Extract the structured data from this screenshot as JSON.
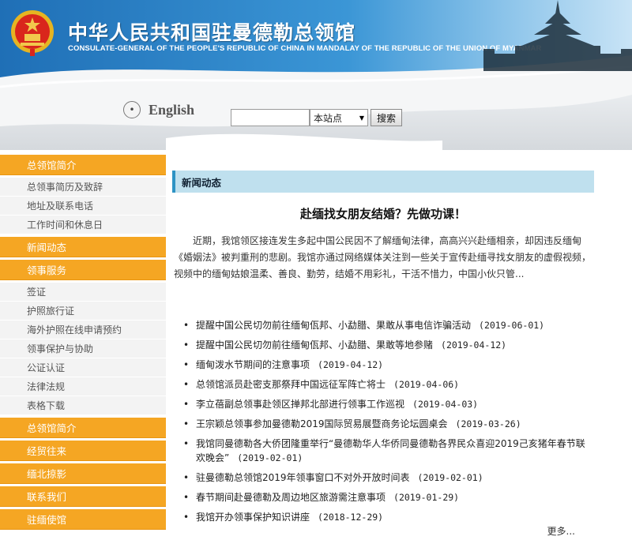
{
  "header": {
    "title_cn": "中华人民共和国驻曼德勒总领馆",
    "title_en": "CONSULATE-GENERAL OF THE PEOPLE'S REPUBLIC OF CHINA IN MANDALAY OF THE REPUBLIC OF THE UNION OF MYANMAR",
    "english_link": "English",
    "search": {
      "input_value": "",
      "scope_selected": "本站点",
      "button_label": "搜索"
    }
  },
  "sidebar": {
    "groups": [
      {
        "title": "总领馆简介",
        "items": [
          "总领事简历及致辞",
          "地址及联系电话",
          "工作时间和休息日"
        ]
      },
      {
        "title": "新闻动态",
        "items": []
      },
      {
        "title": "领事服务",
        "items": [
          "签证",
          "护照旅行证",
          "海外护照在线申请预约",
          "领事保护与协助",
          "公证认证",
          "法律法规",
          "表格下载"
        ]
      },
      {
        "title": "总领馆简介",
        "items": []
      },
      {
        "title": "经贸往来",
        "items": []
      },
      {
        "title": "缅北掠影",
        "items": []
      },
      {
        "title": "联系我们",
        "items": []
      },
      {
        "title": "驻缅使馆",
        "items": []
      }
    ]
  },
  "main": {
    "tab_label": "新闻动态",
    "headline": "赴缅找女朋友结婚？先做功课！",
    "summary": "近期，我馆领区接连发生多起中国公民因不了解缅甸法律，高高兴兴赴缅相亲，却因违反缅甸《婚姻法》被判重刑的悲剧。我馆亦通过网络媒体关注到一些关于宣传赴缅寻找女朋友的虚假视频，视频中的缅甸姑娘温柔、善良、勤劳，结婚不用彩礼，干活不惜力，中国小伙只管...",
    "news": [
      {
        "title": "提醒中国公民切勿前往缅甸佤邦、小勐腊、果敢从事电信诈骗活动",
        "date": "(2019-06-01)"
      },
      {
        "title": "提醒中国公民切勿前往缅甸佤邦、小勐腊、果敢等地参赌",
        "date": "(2019-04-12)"
      },
      {
        "title": "缅甸泼水节期间的注意事项",
        "date": "(2019-04-12)"
      },
      {
        "title": "总领馆派员赴密支那祭拜中国远征军阵亡将士",
        "date": "(2019-04-06)"
      },
      {
        "title": "李立蓓副总领事赴领区掸邦北部进行领事工作巡视",
        "date": "(2019-04-03)"
      },
      {
        "title": "王宗颖总领事参加曼德勒2019国际贸易展暨商务论坛圆桌会",
        "date": "(2019-03-26)"
      },
      {
        "title": "我馆同曼德勒各大侨团隆重举行“曼德勒华人华侨同曼德勒各界民众喜迎2019己亥猪年春节联欢晚会”",
        "date": "(2019-02-01)"
      },
      {
        "title": "驻曼德勒总领馆2019年领事窗口不对外开放时间表",
        "date": "(2019-02-01)"
      },
      {
        "title": "春节期间赴曼德勒及周边地区旅游需注意事项",
        "date": "(2019-01-29)"
      },
      {
        "title": "我馆开办领事保护知识讲座",
        "date": "(2018-12-29)"
      }
    ],
    "more_label": "更多..."
  },
  "colors": {
    "sidebar_accent": "#f5a623",
    "tab_background": "#bfe0ee",
    "tab_border": "#2d93c4",
    "banner_blue": "#2e86c8"
  },
  "icons": [
    "national-emblem-icon",
    "pagoda-icon",
    "circle-dot-icon",
    "dropdown-arrow-icon"
  ]
}
